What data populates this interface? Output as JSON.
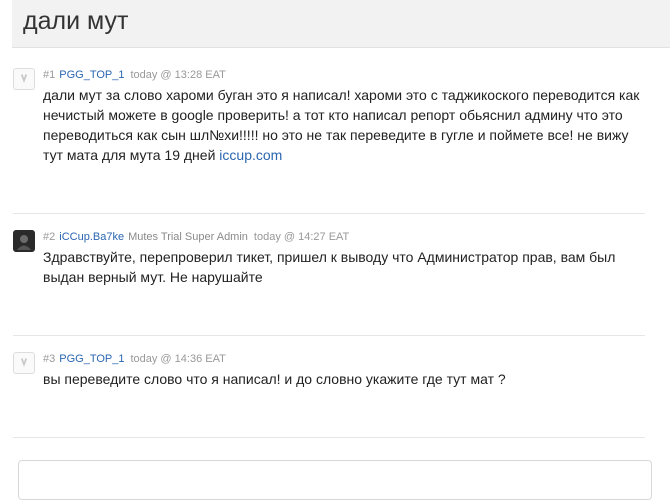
{
  "page": {
    "title": "дали мут"
  },
  "posts": [
    {
      "number": "#1",
      "user": "PGG_TOP_1",
      "role": "",
      "time": "today @ 13:28 EAT",
      "text": "дали мут за слово хароми буган это я написал! хароми это с таджикоского переводится как нечистый можете в google проверить! а тот кто написал репорт обьяснил админу что это переводиться как сын шл№хи!!!!! но это не так переведите в гугле и поймете все! не вижу тут мата для мута 19 дней ",
      "link": "iccup.com",
      "avatar_icon": "user-placeholder-icon"
    },
    {
      "number": "#2",
      "user": "iCCup.Ba7ke",
      "role": "Mutes Trial Super Admin",
      "time": "today @ 14:27 EAT",
      "text": "Здравствуйте, перепроверил тикет, пришел к выводу что Администратор прав, вам был выдан верный мут. Не нарушайте",
      "link": "",
      "avatar_icon": "admin-avatar-icon"
    },
    {
      "number": "#3",
      "user": "PGG_TOP_1",
      "role": "",
      "time": "today @ 14:36 EAT",
      "text": "вы переведите слово что я написал! и до словно укажите где тут мат ?",
      "link": "",
      "avatar_icon": "user-placeholder-icon"
    }
  ]
}
